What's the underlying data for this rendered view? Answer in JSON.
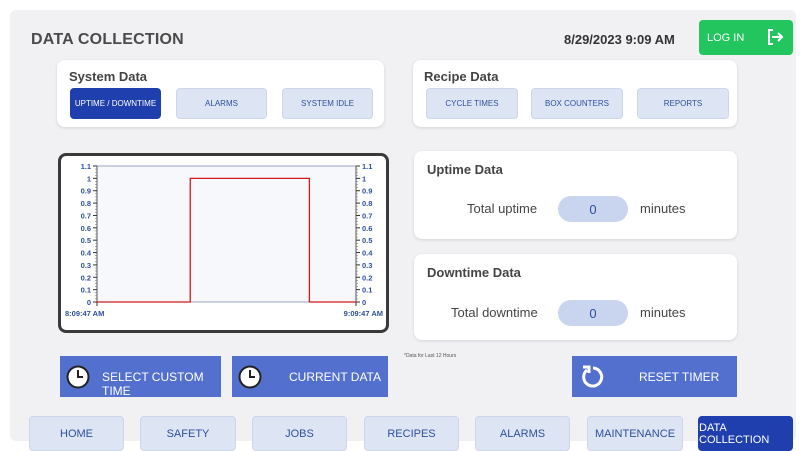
{
  "header": {
    "title": "DATA COLLECTION",
    "datetime": "8/29/2023 9:09 AM",
    "login_label": "LOG IN"
  },
  "system_data": {
    "title": "System Data",
    "buttons": [
      "UPTIME / DOWNTIME",
      "ALARMS",
      "SYSTEM IDLE"
    ],
    "active": "UPTIME / DOWNTIME"
  },
  "recipe_data": {
    "title": "Recipe Data",
    "buttons": [
      "CYCLE TIMES",
      "BOX COUNTERS",
      "REPORTS"
    ]
  },
  "chart_data": {
    "type": "line",
    "x_labels": [
      "8:09:47 AM",
      "9:09:47 AM"
    ],
    "y_ticks": [
      "0",
      "0.1",
      "0.2",
      "0.3",
      "0.4",
      "0.5",
      "0.6",
      "0.7",
      "0.8",
      "0.9",
      "1",
      "1.1"
    ],
    "ylim": [
      0,
      1.1
    ],
    "series": [
      {
        "color": "#d11a1a",
        "points": [
          [
            0,
            0
          ],
          [
            0.36,
            0
          ],
          [
            0.36,
            1
          ],
          [
            0.82,
            1
          ],
          [
            0.82,
            0
          ],
          [
            1,
            0
          ]
        ]
      }
    ],
    "x_range": [
      0,
      1
    ],
    "grid": false
  },
  "uptime": {
    "title": "Uptime Data",
    "label": "Total uptime",
    "value": "0",
    "unit": "minutes"
  },
  "downtime": {
    "title": "Downtime Data",
    "label": "Total downtime",
    "value": "0",
    "unit": "minutes"
  },
  "actions": {
    "select_custom_time": "SELECT CUSTOM TIME",
    "current_data": "CURRENT DATA",
    "reset_timer": "RESET TIMER",
    "note": "*Data for Last 12 Hours"
  },
  "nav": {
    "items": [
      "HOME",
      "SAFETY",
      "JOBS",
      "RECIPES",
      "ALARMS",
      "MAINTENANCE",
      "DATA COLLECTION"
    ],
    "active": "DATA COLLECTION"
  },
  "colors": {
    "accent": "#1f3fae",
    "button": "#5470cf",
    "login": "#22c55e",
    "series": "#d11a1a"
  }
}
